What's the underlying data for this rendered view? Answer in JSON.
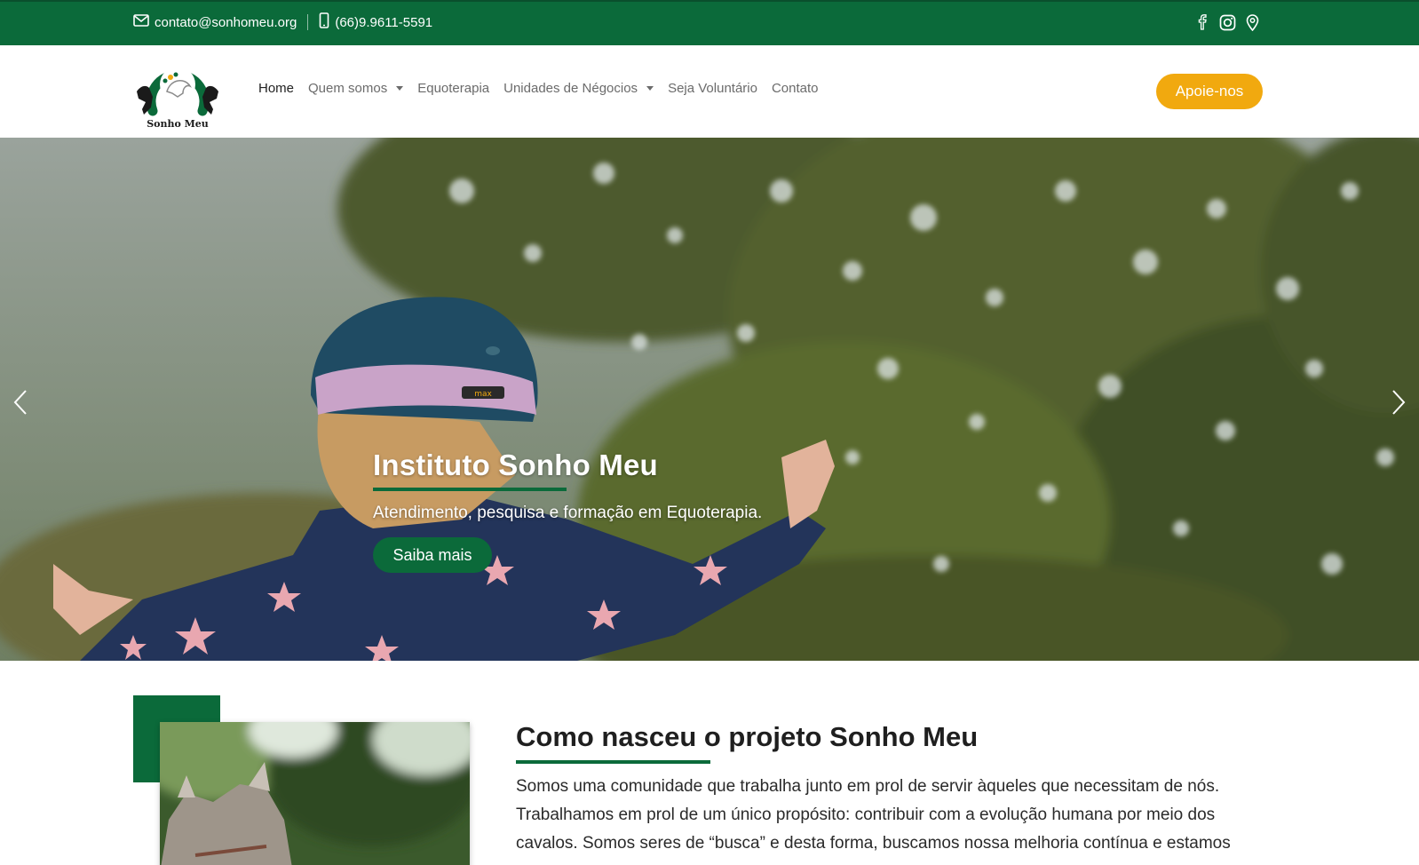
{
  "topbar": {
    "email": "contato@sonhomeu.org",
    "phone": "(66)9.9611-5591",
    "icons": [
      "mail-icon",
      "phone-icon",
      "facebook-icon",
      "instagram-icon",
      "location-icon"
    ]
  },
  "logo": {
    "text": "Sonho Meu"
  },
  "nav": {
    "items": [
      {
        "label": "Home",
        "active": true,
        "dropdown": false
      },
      {
        "label": "Quem somos",
        "active": false,
        "dropdown": true
      },
      {
        "label": "Equoterapia",
        "active": false,
        "dropdown": false
      },
      {
        "label": "Unidades de Négocios",
        "active": false,
        "dropdown": true
      },
      {
        "label": "Seja Voluntário",
        "active": false,
        "dropdown": false
      },
      {
        "label": "Contato",
        "active": false,
        "dropdown": false
      }
    ],
    "cta_label": "Apoie-nos"
  },
  "hero": {
    "title": "Instituto Sonho Meu",
    "subtitle": "Atendimento, pesquisa e formação em Equoterapia.",
    "button_label": "Saiba mais",
    "helmet_brand": "max"
  },
  "about": {
    "title": "Como nasceu o projeto Sonho Meu",
    "text": "Somos uma comunidade que trabalha junto em prol de servir àqueles que necessitam de nós. Trabalhamos em prol de um único propósito: contribuir com a evolução humana por meio dos cavalos. Somos seres de “busca” e desta forma, buscamos nossa melhoria contínua e estamos"
  },
  "colors": {
    "brand_green": "#0b6a3a",
    "accent_yellow": "#f1a90f"
  }
}
